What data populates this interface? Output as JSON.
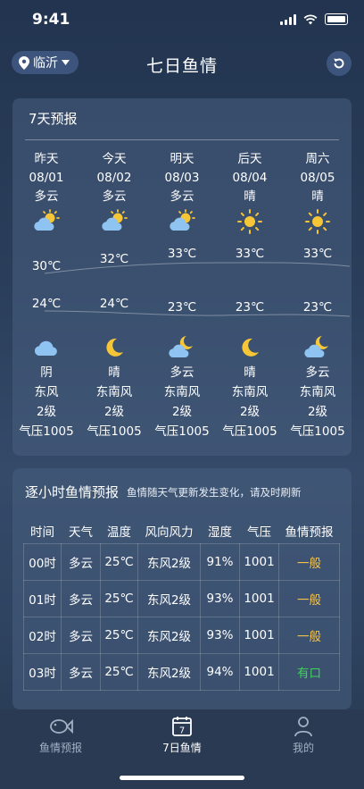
{
  "status": {
    "time": "9:41"
  },
  "header": {
    "city": "临沂",
    "title": "七日鱼情"
  },
  "forecast7": {
    "title": "7天预报",
    "days": [
      {
        "name": "昨天",
        "date": "08/01",
        "day_weather": "多云",
        "day_icon": "partly-cloudy-icon",
        "high": "30℃",
        "low": "24℃",
        "night_icon": "cloud-icon",
        "night_weather": "阴",
        "wind_dir": "东风",
        "wind_level": "2级",
        "pressure": "气压1005"
      },
      {
        "name": "今天",
        "date": "08/02",
        "day_weather": "多云",
        "day_icon": "partly-cloudy-icon",
        "high": "32℃",
        "low": "24℃",
        "night_icon": "moon-icon",
        "night_weather": "晴",
        "wind_dir": "东南风",
        "wind_level": "2级",
        "pressure": "气压1005"
      },
      {
        "name": "明天",
        "date": "08/03",
        "day_weather": "多云",
        "day_icon": "partly-cloudy-icon",
        "high": "33℃",
        "low": "23℃",
        "night_icon": "cloudy-moon-icon",
        "night_weather": "多云",
        "wind_dir": "东南风",
        "wind_level": "2级",
        "pressure": "气压1005"
      },
      {
        "name": "后天",
        "date": "08/04",
        "day_weather": "晴",
        "day_icon": "sun-icon",
        "high": "33℃",
        "low": "23℃",
        "night_icon": "moon-icon",
        "night_weather": "晴",
        "wind_dir": "东南风",
        "wind_level": "2级",
        "pressure": "气压1005"
      },
      {
        "name": "周六",
        "date": "08/05",
        "day_weather": "晴",
        "day_icon": "sun-icon",
        "high": "33℃",
        "low": "23℃",
        "night_icon": "cloudy-moon-icon",
        "night_weather": "多云",
        "wind_dir": "东南风",
        "wind_level": "2级",
        "pressure": "气压1005"
      }
    ]
  },
  "hourly": {
    "title": "逐小时鱼情预报",
    "note": "鱼情随天气更新发生变化，请及时刷新",
    "columns": [
      "时间",
      "天气",
      "温度",
      "风向风力",
      "湿度",
      "气压",
      "鱼情预报"
    ],
    "rows": [
      {
        "time": "00时",
        "weather": "多云",
        "temp": "25℃",
        "wind": "东风2级",
        "humidity": "91%",
        "pressure": "1001",
        "fish": "一般",
        "fish_color": "#f4c24a"
      },
      {
        "time": "01时",
        "weather": "多云",
        "temp": "25℃",
        "wind": "东风2级",
        "humidity": "93%",
        "pressure": "1001",
        "fish": "一般",
        "fish_color": "#f4c24a"
      },
      {
        "time": "02时",
        "weather": "多云",
        "temp": "25℃",
        "wind": "东风2级",
        "humidity": "93%",
        "pressure": "1001",
        "fish": "一般",
        "fish_color": "#f4c24a"
      },
      {
        "time": "03时",
        "weather": "多云",
        "temp": "25℃",
        "wind": "东风2级",
        "humidity": "94%",
        "pressure": "1001",
        "fish": "有口",
        "fish_color": "#3ed35a"
      }
    ]
  },
  "tabs": [
    {
      "label": "鱼情预报",
      "icon": "fish-icon",
      "active": false
    },
    {
      "label": "7日鱼情",
      "icon": "calendar-7-icon",
      "active": true,
      "badge": "7"
    },
    {
      "label": "我的",
      "icon": "user-icon",
      "active": false
    }
  ],
  "colors": {
    "accent_normal": "#f4c24a",
    "accent_good": "#3ed35a",
    "sun": "#f6c636",
    "cloud": "#8fc3f2"
  }
}
